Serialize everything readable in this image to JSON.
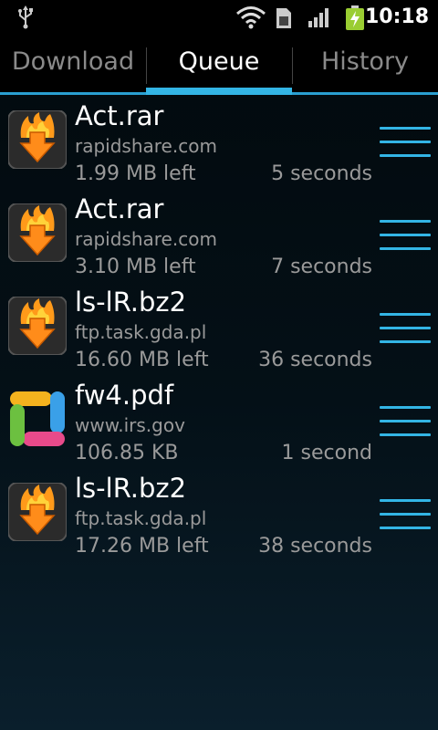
{
  "status_bar": {
    "time": "10:18",
    "icons": [
      "usb-icon",
      "wifi-icon",
      "sim-icon",
      "signal-icon",
      "battery-charging-icon"
    ]
  },
  "tabs": [
    {
      "label": "Download",
      "active": false
    },
    {
      "label": "Queue",
      "active": true
    },
    {
      "label": "History",
      "active": false
    }
  ],
  "colors": {
    "accent": "#33b5e5",
    "secondary_text": "#9a9a9a",
    "inactive_tab": "#8a8a8a"
  },
  "queue": [
    {
      "name": "Act.rar",
      "host": "rapidshare.com",
      "remaining": "1.99 MB left",
      "eta": "5 seconds",
      "icon": "flame-download-icon"
    },
    {
      "name": "Act.rar",
      "host": "rapidshare.com",
      "remaining": "3.10 MB left",
      "eta": "7 seconds",
      "icon": "flame-download-icon"
    },
    {
      "name": "ls-lR.bz2",
      "host": "ftp.task.gda.pl",
      "remaining": "16.60 MB left",
      "eta": "36 seconds",
      "icon": "flame-download-icon"
    },
    {
      "name": "fw4.pdf",
      "host": "www.irs.gov",
      "remaining": "106.85 KB",
      "eta": "1 second",
      "icon": "colorful-square-icon"
    },
    {
      "name": "ls-lR.bz2",
      "host": "ftp.task.gda.pl",
      "remaining": "17.26 MB left",
      "eta": "38 seconds",
      "icon": "flame-download-icon"
    }
  ]
}
